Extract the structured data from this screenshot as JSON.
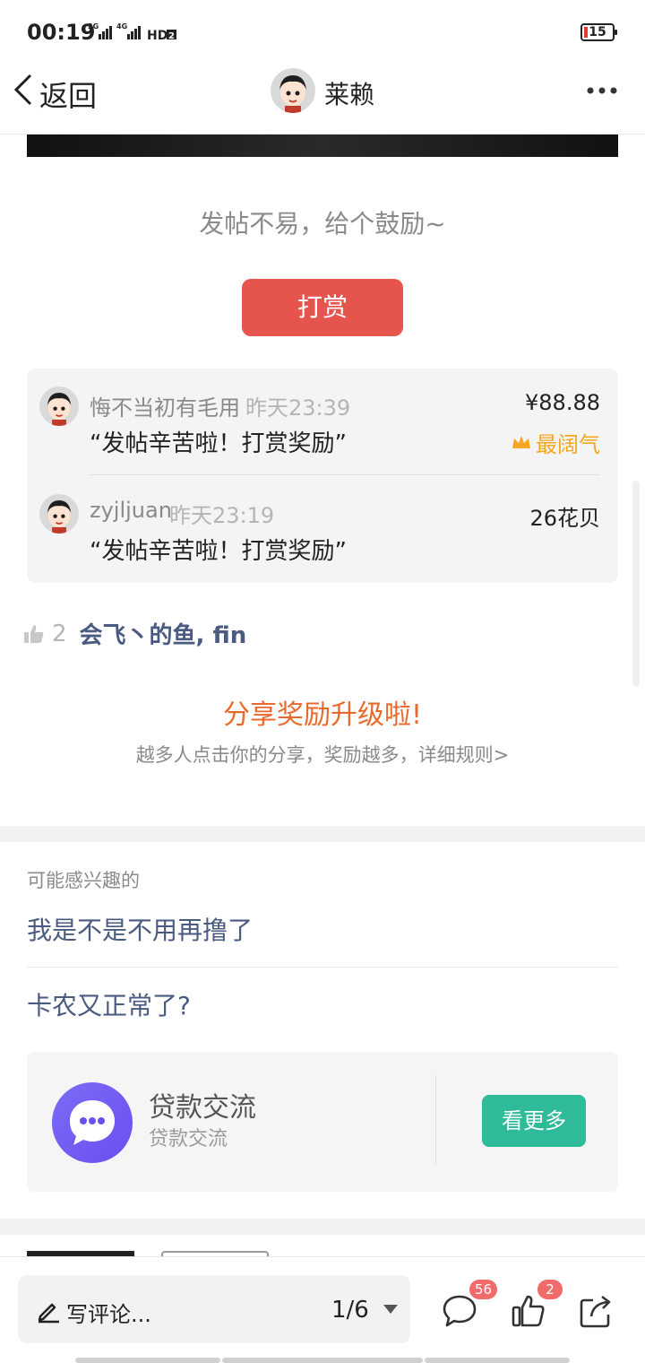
{
  "status_bar": {
    "time": "00:19",
    "battery": "15"
  },
  "nav": {
    "back_label": "返回",
    "title": "莱赖"
  },
  "post": {
    "encourage_text": "发帖不易，给个鼓励~",
    "tip_button": "打赏"
  },
  "rewards": [
    {
      "name": "悔不当初有毛用",
      "time": "昨天23:39",
      "message": "“发帖辛苦啦！打赏奖励”",
      "amount": "¥88.88",
      "badge": "最阔气"
    },
    {
      "name": "zyjljuan",
      "time": "昨天23:19",
      "message": "“发帖辛苦啦！打赏奖励”",
      "amount": "26花贝"
    }
  ],
  "likes": {
    "count": "2",
    "names": "会飞丶的鱼, fin"
  },
  "share": {
    "title": "分享奖励升级啦!",
    "subtitle": "越多人点击你的分享，奖励越多，详细规则>"
  },
  "interest": {
    "label": "可能感兴趣的",
    "items": [
      "我是不是不用再撸了",
      "卡农又正常了?"
    ]
  },
  "card": {
    "title": "贷款交流",
    "subtitle": "贷款交流",
    "button": "看更多"
  },
  "bottom_bar": {
    "comment_placeholder": "写评论...",
    "page_indicator": "1/6",
    "comment_badge": "56",
    "like_badge": "2"
  },
  "colors": {
    "tip_red": "#e5554d",
    "share_orange": "#e9692c",
    "link_blue": "#4a5a80",
    "card_green": "#2fba99",
    "badge_gold": "#f5a623"
  }
}
